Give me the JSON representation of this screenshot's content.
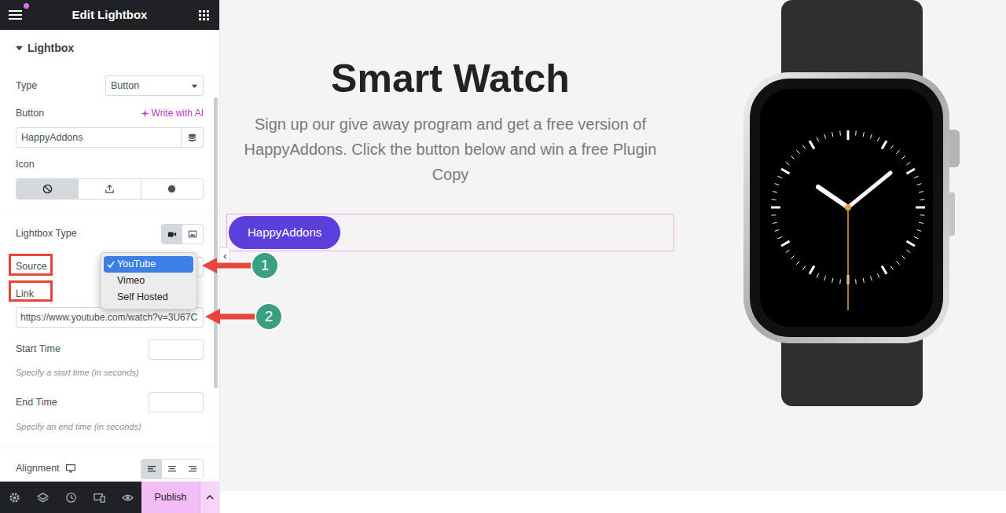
{
  "panel": {
    "title": "Edit Lightbox"
  },
  "section": {
    "title": "Lightbox",
    "expanded": true
  },
  "controls": {
    "type": {
      "label": "Type",
      "value": "Button"
    },
    "button": {
      "label": "Button",
      "ai": "Write with AI",
      "value": "HappyAddons"
    },
    "icon": {
      "label": "Icon",
      "options": [
        {
          "selected": true
        },
        {
          "selected": false
        },
        {
          "selected": false
        }
      ]
    },
    "lightbox_type": {
      "label": "Lightbox Type",
      "options": [
        {
          "selected": true
        },
        {
          "selected": false
        }
      ]
    },
    "source": {
      "label": "Source",
      "expanded": true,
      "options": [
        {
          "label": "YouTube",
          "selected": true
        },
        {
          "label": "Vimeo",
          "selected": false
        },
        {
          "label": "Self Hosted",
          "selected": false
        }
      ]
    },
    "link": {
      "label": "Link",
      "value": "https://www.youtube.com/watch?v=3U67C"
    },
    "start_time": {
      "label": "Start Time",
      "hint": "Specify a start time (in seconds)"
    },
    "end_time": {
      "label": "End Time",
      "hint": "Specify an end time (in seconds)"
    },
    "alignment": {
      "label": "Alignment",
      "options": [
        {
          "selected": true
        },
        {
          "selected": false
        },
        {
          "selected": false
        }
      ]
    }
  },
  "footer": {
    "publish": "Publish"
  },
  "canvas": {
    "heading": "Smart Watch",
    "text": "Sign up our give away program and get a free version of HappyAddons. Click the button below and win a free Plugin Copy",
    "button": "HappyAddons",
    "widget_selected": true
  },
  "annotations": [
    {
      "label": "1"
    },
    {
      "label": "2"
    }
  ]
}
